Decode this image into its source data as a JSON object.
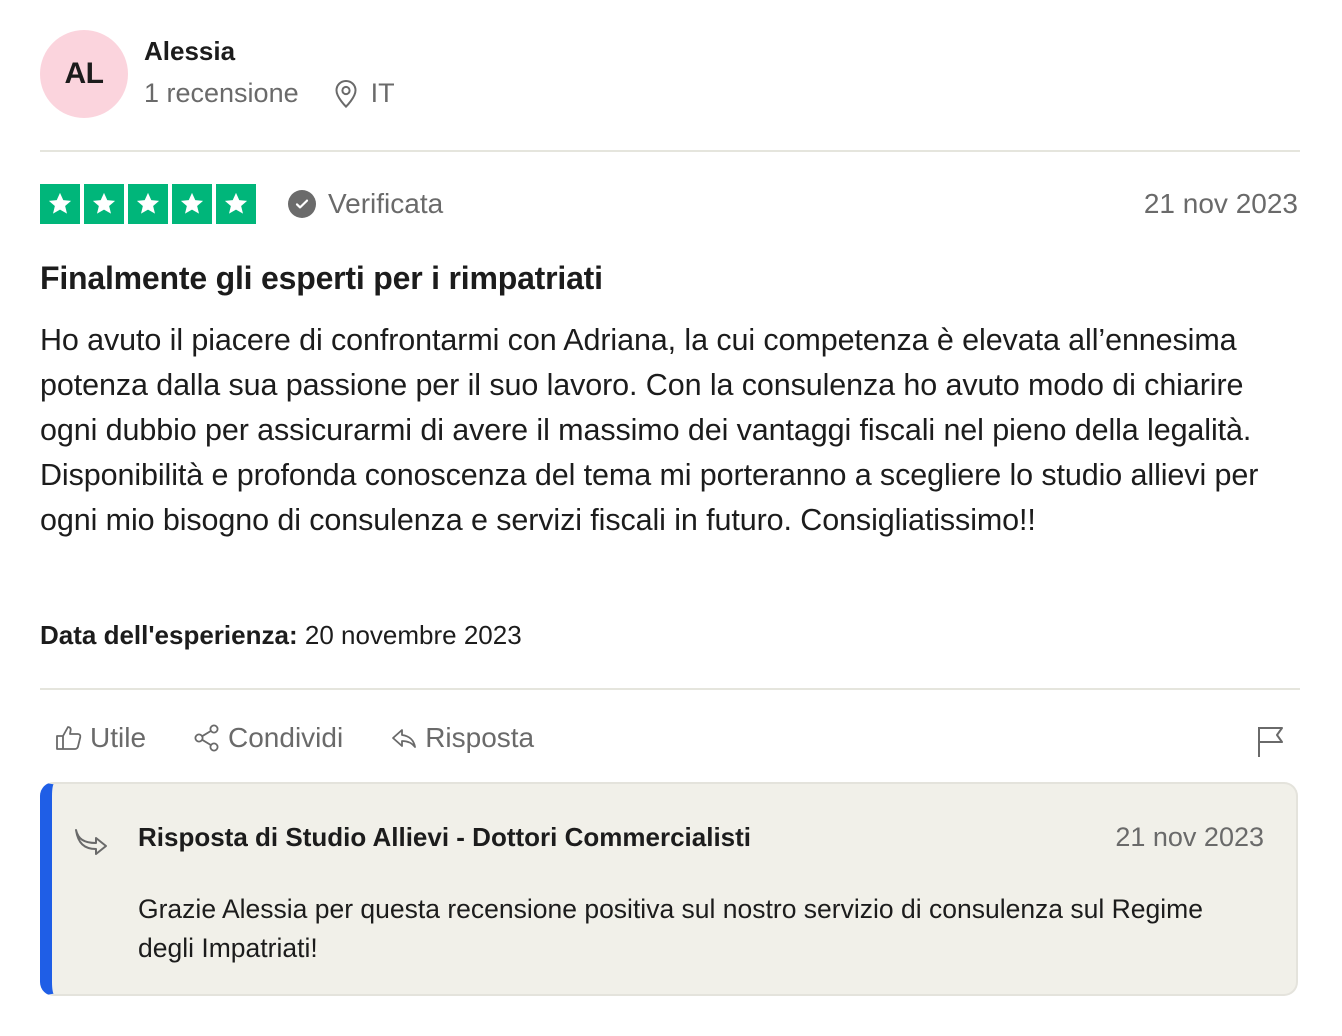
{
  "reviewer": {
    "initials": "AL",
    "name": "Alessia",
    "review_count": "1 recensione",
    "country": "IT",
    "avatar_color": "#fbd4dd"
  },
  "review": {
    "rating": 5,
    "rating_max": 5,
    "star_color": "#00b67a",
    "verified_label": "Verificata",
    "date": "21 nov 2023",
    "title": "Finalmente gli esperti per i rimpatriati",
    "body": "Ho avuto il piacere di confrontarmi con Adriana, la cui competenza è elevata all’ennesima potenza dalla sua passione per il suo lavoro. Con la consulenza ho avuto modo di chiarire ogni dubbio per assicurarmi di avere il massimo dei vantaggi fiscali nel pieno della legalità. Disponibilità e profonda conoscenza del tema mi porteranno a scegliere lo studio allievi per ogni mio bisogno di consulenza e servizi fiscali in futuro. Consigliatissimo!!",
    "experience_label": "Data dell'esperienza:",
    "experience_date": "20 novembre 2023"
  },
  "actions": {
    "useful": "Utile",
    "share": "Condividi",
    "reply": "Risposta",
    "icons": [
      "thumbs-up-icon",
      "share-icon",
      "reply-icon",
      "flag-icon"
    ]
  },
  "company_reply": {
    "title": "Risposta di Studio Allievi - Dottori Commercialisti",
    "date": "21 nov 2023",
    "body": "Grazie Alessia per questa recensione positiva sul nostro servizio di consulenza sul Regime degli Impatriati!",
    "accent_color": "#1f5ee6"
  }
}
